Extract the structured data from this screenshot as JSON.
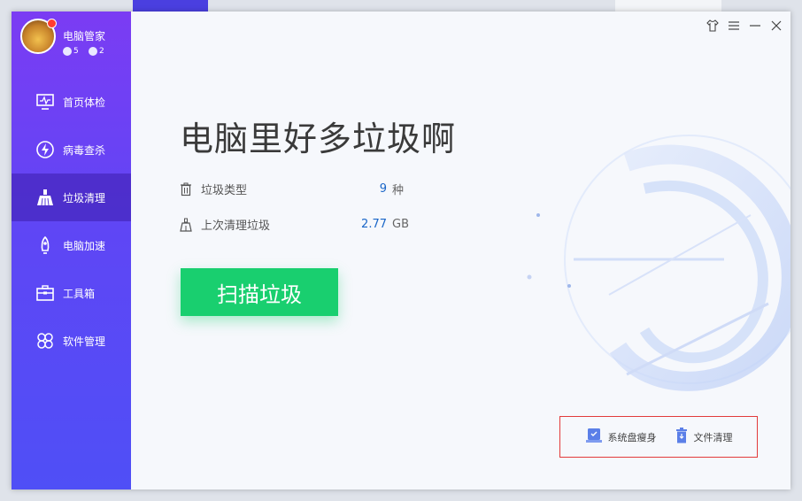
{
  "app": {
    "name": "电脑管家",
    "badge1": "5",
    "badge2": "2"
  },
  "nav": [
    {
      "label": "首页体检",
      "icon": "monitor-icon"
    },
    {
      "label": "病毒查杀",
      "icon": "lightning-icon"
    },
    {
      "label": "垃圾清理",
      "icon": "broom-icon",
      "active": true
    },
    {
      "label": "电脑加速",
      "icon": "rocket-icon"
    },
    {
      "label": "工具箱",
      "icon": "toolbox-icon"
    },
    {
      "label": "软件管理",
      "icon": "apps-icon"
    }
  ],
  "main": {
    "headline": "电脑里好多垃圾啊",
    "stats": [
      {
        "label": "垃圾类型",
        "value": "9",
        "unit": "种",
        "icon": "trash-icon"
      },
      {
        "label": "上次清理垃圾",
        "value": "2.77",
        "unit": "GB",
        "icon": "broom-icon"
      }
    ],
    "scan_button": "扫描垃圾",
    "tools": [
      {
        "label": "系统盘瘦身",
        "icon": "disk-icon"
      },
      {
        "label": "文件清理",
        "icon": "trash-can-icon"
      }
    ]
  },
  "colors": {
    "accent": "#19cf6f",
    "sidebar_top": "#7b3cf3",
    "sidebar_bottom": "#4f4ff6",
    "value_blue": "#1a66c8",
    "highlight_border": "#e23b3b"
  }
}
